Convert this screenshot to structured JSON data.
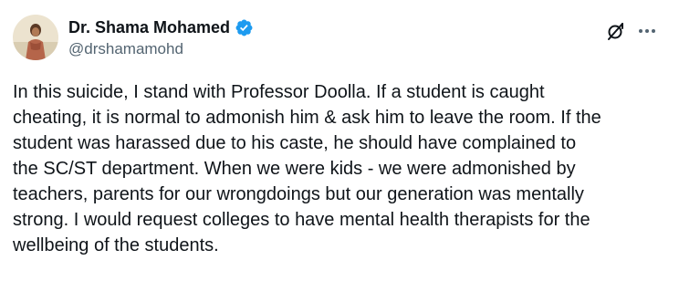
{
  "tweet": {
    "author": {
      "display_name": "Dr. Shama Mohamed",
      "handle": "@drshamamohd",
      "verified": true
    },
    "text": "In this suicide, I stand with Professor Doolla. If a student is caught\ncheating, it is normal to admonish him & ask him to leave the room. If the\nstudent was harassed due to his caste, he should have complained to\nthe SC/ST department. When we were kids - we were admonished by\nteachers, parents for our wrongdoings but our generation was mentally\nstrong. I would request colleges to have mental health therapists for the\nwellbeing of the students."
  },
  "icons": {
    "verified": "verified-badge-icon",
    "grok": "grok-icon",
    "more": "more-options-icon"
  },
  "colors": {
    "text_primary": "#0f1419",
    "text_secondary": "#536471",
    "verified_blue": "#1d9bf0",
    "background": "#ffffff"
  }
}
